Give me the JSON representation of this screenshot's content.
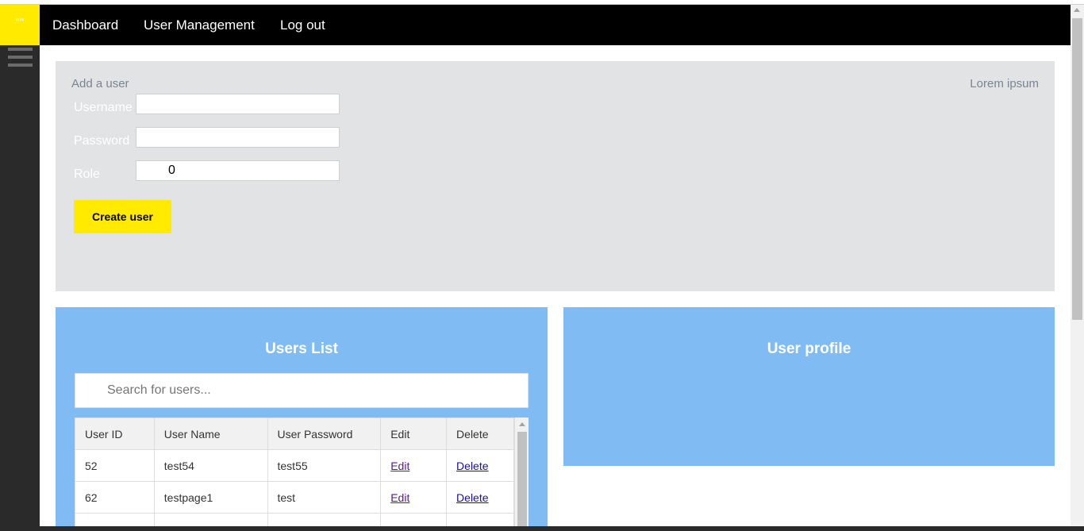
{
  "logo": {
    "text": "\"\""
  },
  "nav": {
    "items": [
      {
        "label": "Dashboard"
      },
      {
        "label": "User Management"
      },
      {
        "label": "Log out"
      }
    ]
  },
  "add_user": {
    "title": "Add a user",
    "right_text": "Lorem ipsum",
    "username_label": "Username",
    "username_value": "",
    "password_label": "Password",
    "password_value": "",
    "role_label": "Role",
    "role_value": "0",
    "create_label": "Create user"
  },
  "users_list": {
    "title": "Users List",
    "search_placeholder": "Search for users...",
    "columns": [
      "User ID",
      "User Name",
      "User Password",
      "Edit",
      "Delete"
    ],
    "rows": [
      {
        "id": "52",
        "name": "test54",
        "password": "test55",
        "edit": "Edit",
        "delete": "Delete"
      },
      {
        "id": "62",
        "name": "testpage1",
        "password": "test",
        "edit": "Edit",
        "delete": "Delete"
      }
    ]
  },
  "user_profile": {
    "title": "User profile"
  },
  "colors": {
    "accent_yellow": "#ffea00",
    "panel_blue": "#80bcf3",
    "panel_gray": "#e2e3e5",
    "navbar": "#000000"
  }
}
